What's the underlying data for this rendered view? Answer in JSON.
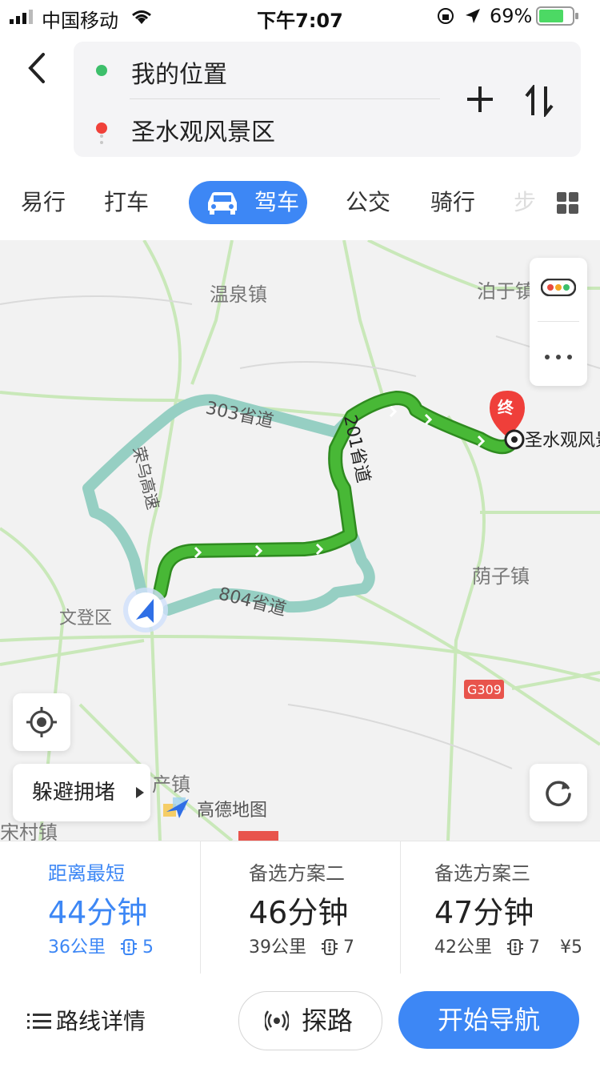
{
  "status_bar": {
    "carrier": "中国移动",
    "time": "下午7:07",
    "battery": "69%"
  },
  "route": {
    "origin": "我的位置",
    "destination": "圣水观风景区",
    "origin_color": "#3dbf6b",
    "destination_color": "#f0413a"
  },
  "modes": {
    "tabs": [
      "易行",
      "打车",
      "驾车",
      "公交",
      "骑行",
      "步"
    ],
    "active": "驾车"
  },
  "map": {
    "labels": {
      "wenquan": "温泉镇",
      "bozi": "泊于镇",
      "yinzi": "荫子镇",
      "wendeng": "文登区",
      "chanzhen": "产镇",
      "songcun": "宋村镇",
      "road_303": "303省道",
      "road_201": "201省道",
      "road_804": "804省道",
      "expressway": "荣乌高速",
      "g309": "G309",
      "dest_label": "圣水观风景",
      "end_marker": "终"
    },
    "avoid_congestion": "躲避拥堵",
    "brand": "高德地图",
    "route_colors": {
      "main": "#3aa92e",
      "alt": "#96cfc3"
    }
  },
  "options": [
    {
      "title": "距离最短",
      "duration": "44分钟",
      "distance": "36公里",
      "lights": "5",
      "fee": ""
    },
    {
      "title": "备选方案二",
      "duration": "46分钟",
      "distance": "39公里",
      "lights": "7",
      "fee": ""
    },
    {
      "title": "备选方案三",
      "duration": "47分钟",
      "distance": "42公里",
      "lights": "7",
      "fee": "¥5"
    }
  ],
  "bottom": {
    "details": "路线详情",
    "probe": "探路",
    "start_nav": "开始导航"
  }
}
